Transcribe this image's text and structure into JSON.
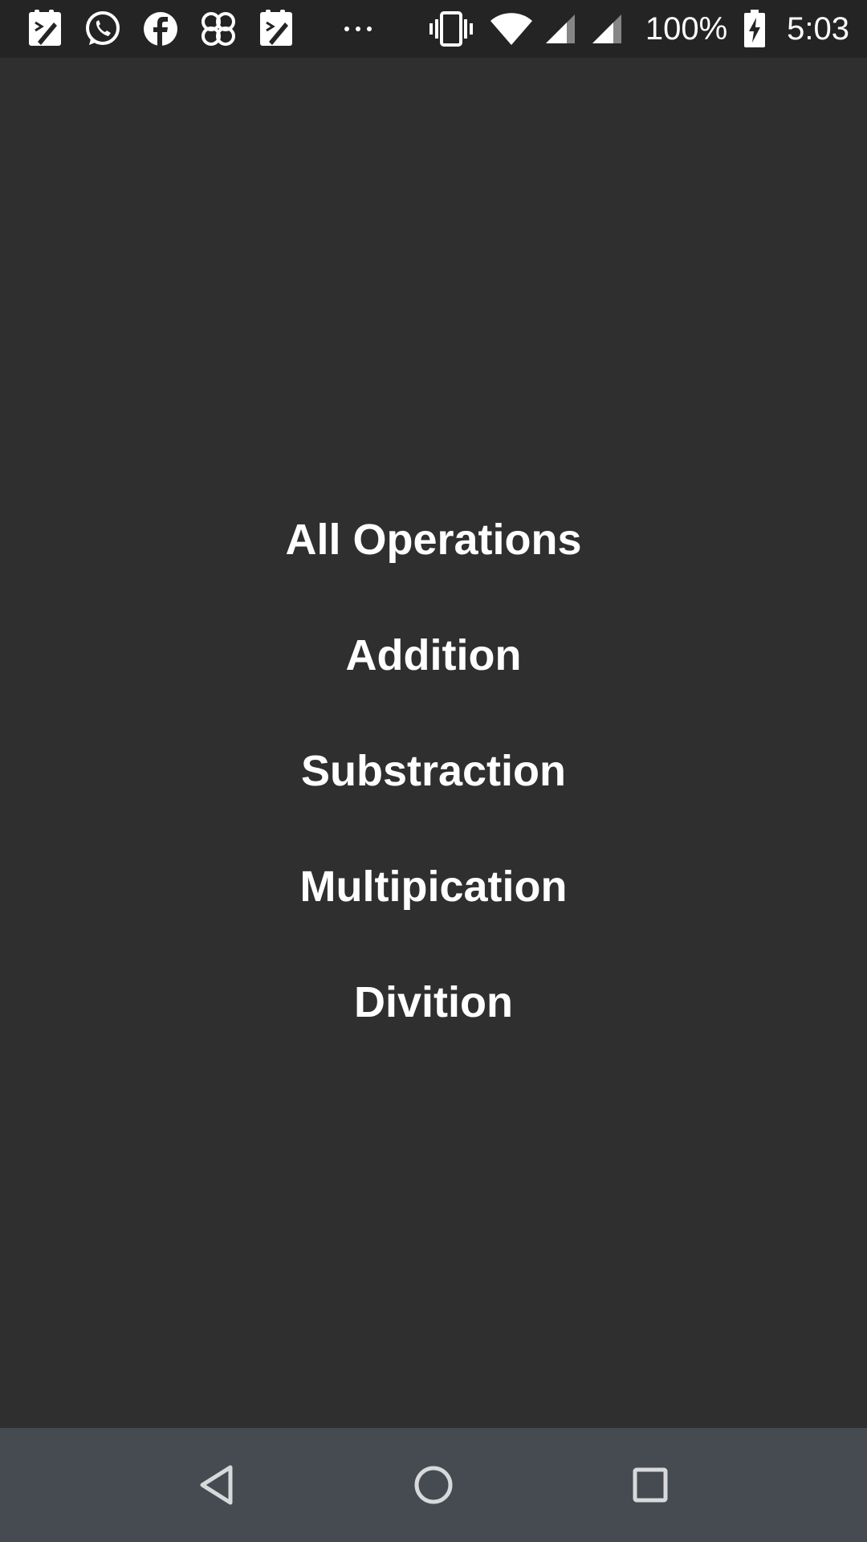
{
  "status_bar": {
    "notification_icons": [
      "writing-app-icon",
      "whatsapp-icon",
      "facebook-icon",
      "clover-app-icon",
      "writing-app-icon"
    ],
    "more_indicator": "···",
    "system_icons": [
      "vibrate-icon",
      "wifi-icon",
      "signal-icon",
      "signal-icon"
    ],
    "battery_percent": "100%",
    "battery_icon": "battery-charging-icon",
    "time": "5:03"
  },
  "menu": {
    "items": [
      {
        "label": "All Operations"
      },
      {
        "label": "Addition"
      },
      {
        "label": "Substraction"
      },
      {
        "label": "Multipication"
      },
      {
        "label": "Divition"
      }
    ]
  },
  "nav_bar": {
    "icons": [
      "back-icon",
      "home-icon",
      "recents-icon"
    ]
  },
  "colors": {
    "background": "#2f2f2f",
    "status_bar": "#242424",
    "nav_bar": "#454b51",
    "text": "#ffffff"
  }
}
